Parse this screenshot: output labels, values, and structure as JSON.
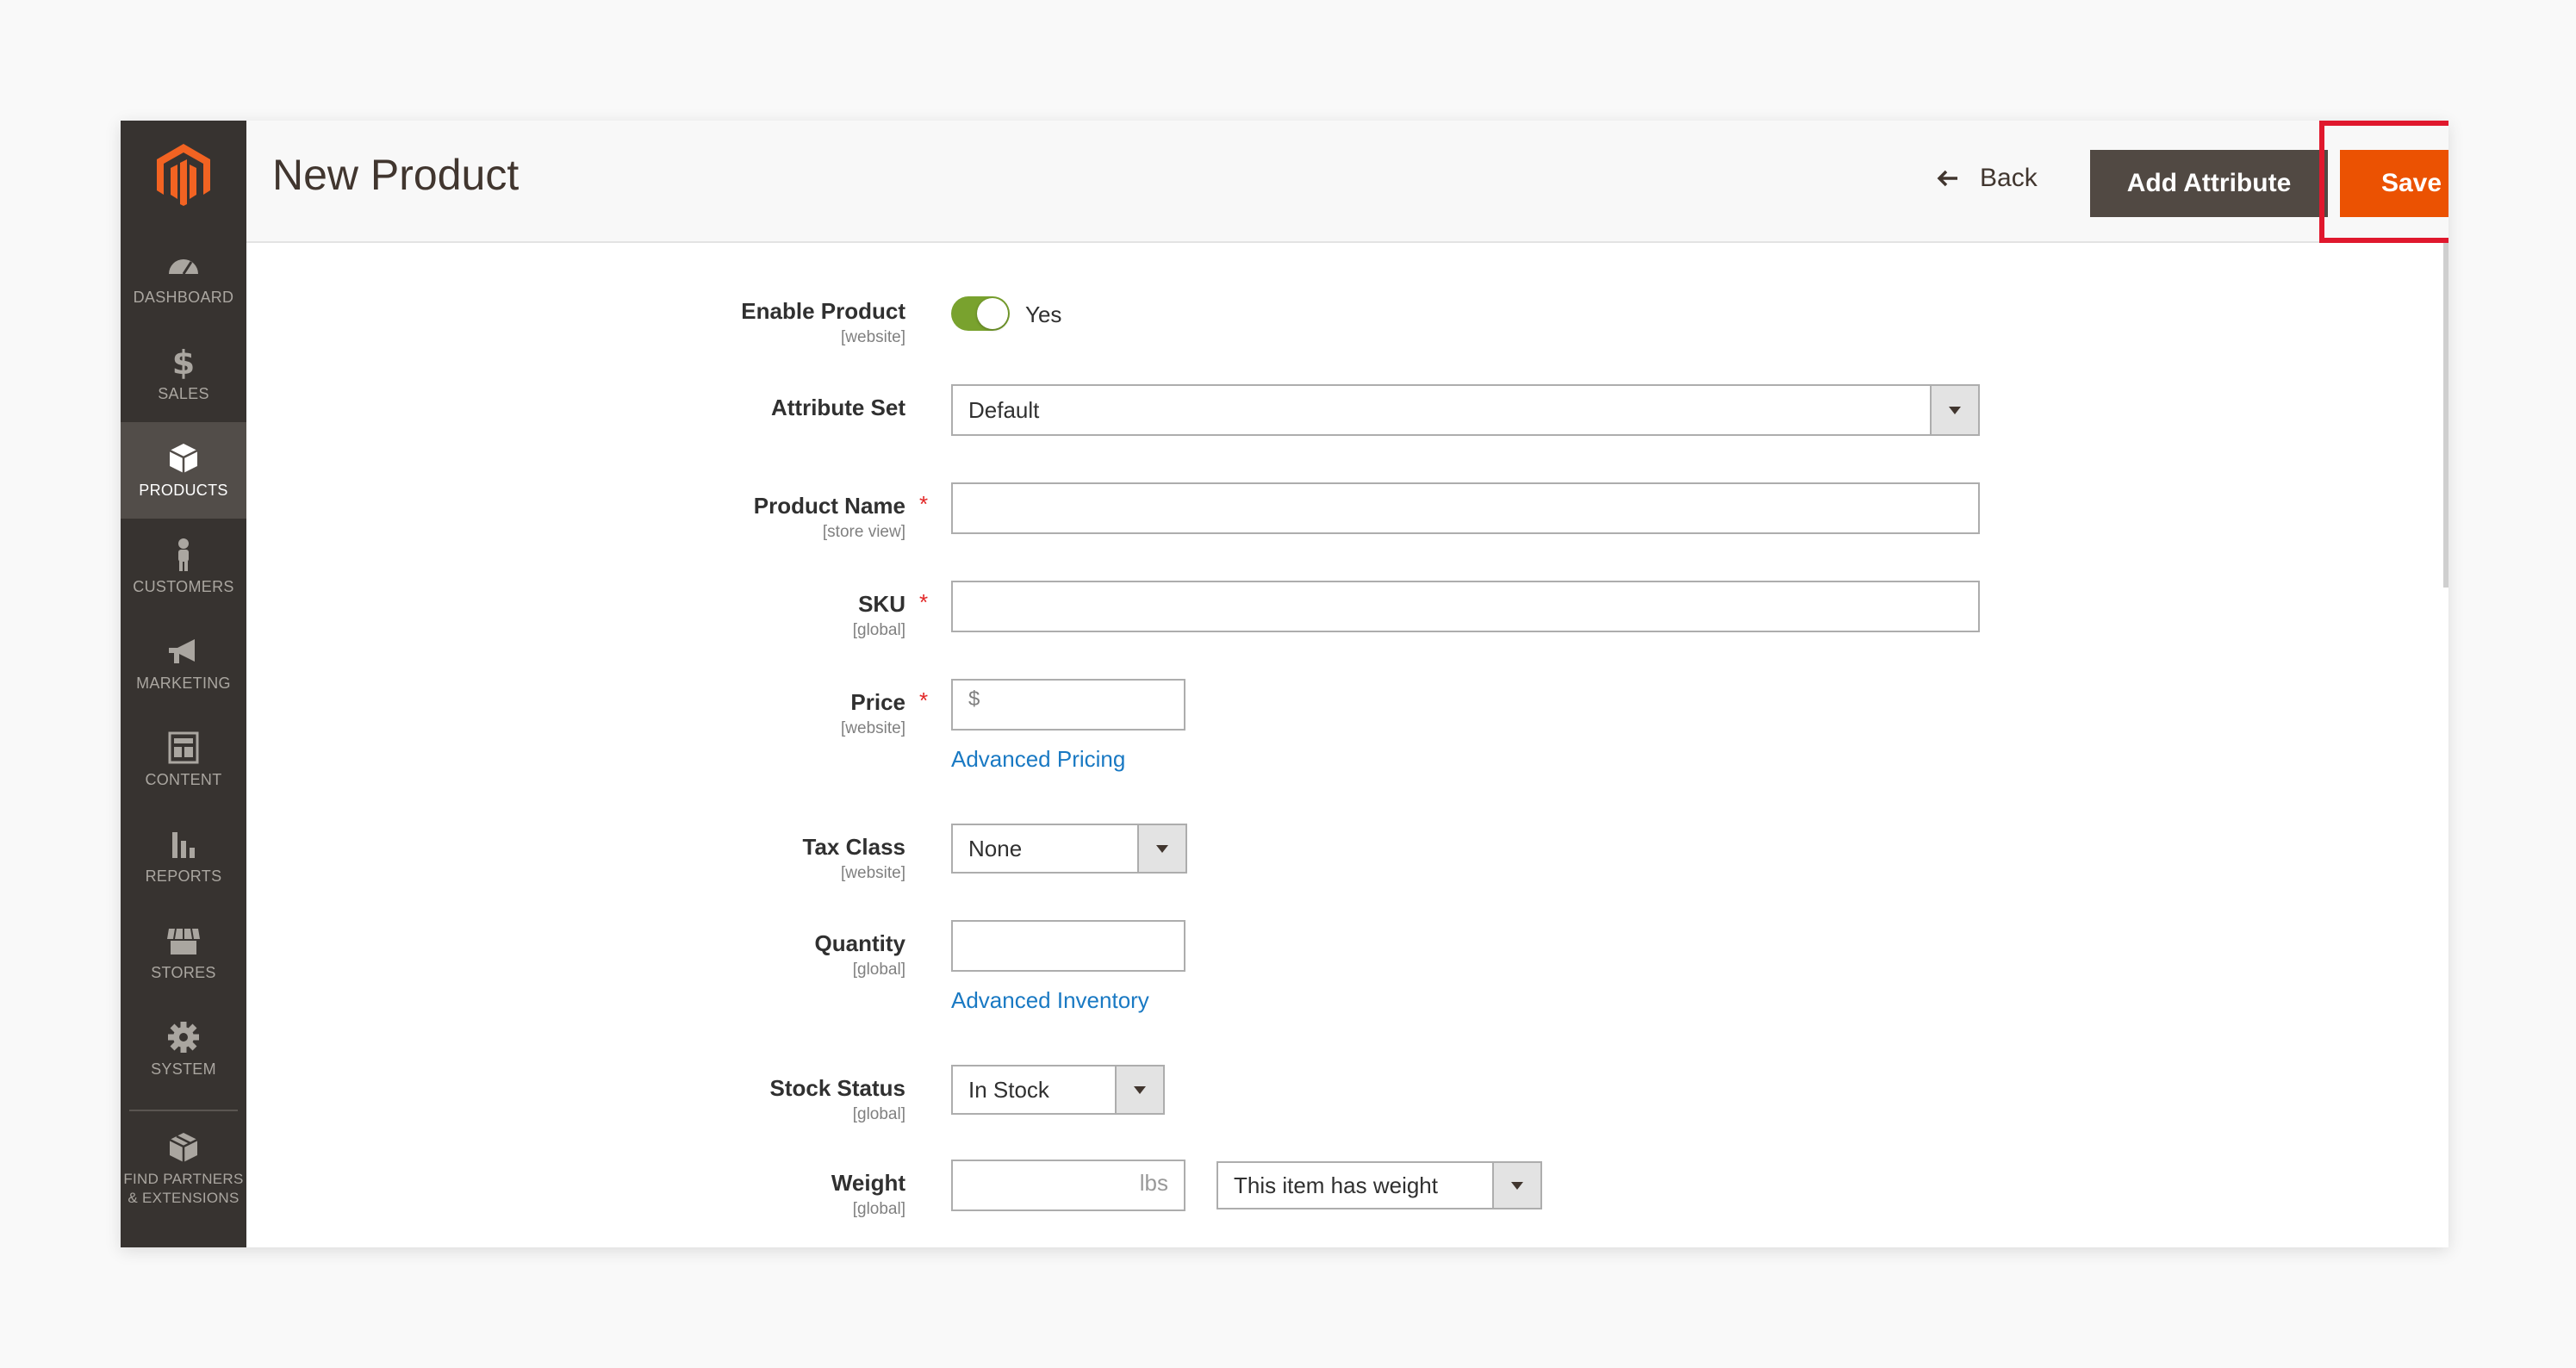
{
  "sidebar": {
    "items": [
      {
        "label": "DASHBOARD",
        "icon": "dashboard-icon"
      },
      {
        "label": "SALES",
        "icon": "dollar-icon"
      },
      {
        "label": "PRODUCTS",
        "icon": "box-icon"
      },
      {
        "label": "CUSTOMERS",
        "icon": "person-icon"
      },
      {
        "label": "MARKETING",
        "icon": "megaphone-icon"
      },
      {
        "label": "CONTENT",
        "icon": "layout-icon"
      },
      {
        "label": "REPORTS",
        "icon": "bar-chart-icon"
      },
      {
        "label": "STORES",
        "icon": "store-icon"
      },
      {
        "label": "SYSTEM",
        "icon": "gear-icon"
      },
      {
        "label": "FIND PARTNERS & EXTENSIONS",
        "icon": "cube-icon"
      }
    ],
    "active": "PRODUCTS"
  },
  "header": {
    "title": "New Product",
    "back_label": "Back",
    "add_attribute_label": "Add Attribute",
    "save_label": "Save"
  },
  "form": {
    "enable_product": {
      "label": "Enable Product",
      "scope": "[website]",
      "value": "Yes"
    },
    "attribute_set": {
      "label": "Attribute Set",
      "value": "Default"
    },
    "product_name": {
      "label": "Product Name",
      "scope": "[store view]",
      "value": "",
      "required": "*"
    },
    "sku": {
      "label": "SKU",
      "scope": "[global]",
      "value": "",
      "required": "*"
    },
    "price": {
      "label": "Price",
      "scope": "[website]",
      "prefix": "$",
      "required": "*",
      "link": "Advanced Pricing"
    },
    "tax_class": {
      "label": "Tax Class",
      "scope": "[website]",
      "value": "None"
    },
    "quantity": {
      "label": "Quantity",
      "scope": "[global]",
      "value": "",
      "link": "Advanced Inventory"
    },
    "stock_status": {
      "label": "Stock Status",
      "scope": "[global]",
      "value": "In Stock"
    },
    "weight": {
      "label": "Weight",
      "scope": "[global]",
      "unit": "lbs",
      "option": "This item has weight"
    }
  },
  "colors": {
    "save": "#eb5202",
    "add_attribute": "#514943",
    "sidebar": "#373330",
    "toggle_on": "#79a22e",
    "link": "#1979c3",
    "highlight": "#e0182d"
  }
}
